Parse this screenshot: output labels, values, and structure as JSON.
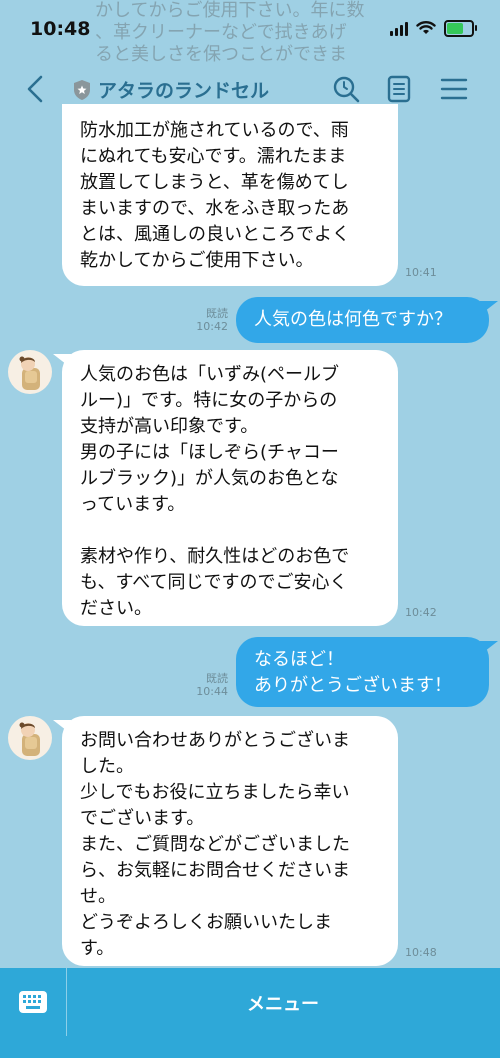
{
  "status": {
    "time": "10:48"
  },
  "behind_text": "かしてからご使用下さい。年に数\n、革クリーナーなどで拭きあげ\nると美しさを保つことができま",
  "header": {
    "title": "アタラのランドセル"
  },
  "messages": [
    {
      "text": "防水加工が施されているので、雨\nにぬれても安心です。濡れたまま\n放置してしまうと、革を傷めてし\nまいますので、水をふき取ったあ\nとは、風通しの良いところでよく\n乾かしてからご使用下さい。",
      "time": "10:41"
    },
    {
      "text": "人気の色は何色ですか？",
      "read": "既読",
      "time": "10:42"
    },
    {
      "text": "人気のお色は「いずみ(ペールブ\nルー)」です。特に女の子からの\n支持が高い印象です。\n男の子には「ほしぞら(チャコー\nルブラック)」が人気のお色とな\nっています。\n\n素材や作り、耐久性はどのお色で\nも、すべて同じですのでご安心く\nださい。",
      "time": "10:42"
    },
    {
      "text": "なるほど！\nありがとうございます！",
      "read": "既読",
      "time": "10:44"
    },
    {
      "text": "お問い合わせありがとうございま\nした。\n少しでもお役に立ちましたら幸い\nでございます。\nまた、ご質問などがございました\nら、お気軽にお問合せくださいま\nせ。\nどうぞよろしくお願いいたしま\nす。",
      "time": "10:48"
    }
  ],
  "footer": {
    "menu_label": "メニュー"
  },
  "colors": {
    "background": "#9fd0e4",
    "outgoing": "#32a7e8",
    "footer": "#2ea8d8",
    "title": "#2a6f91"
  }
}
